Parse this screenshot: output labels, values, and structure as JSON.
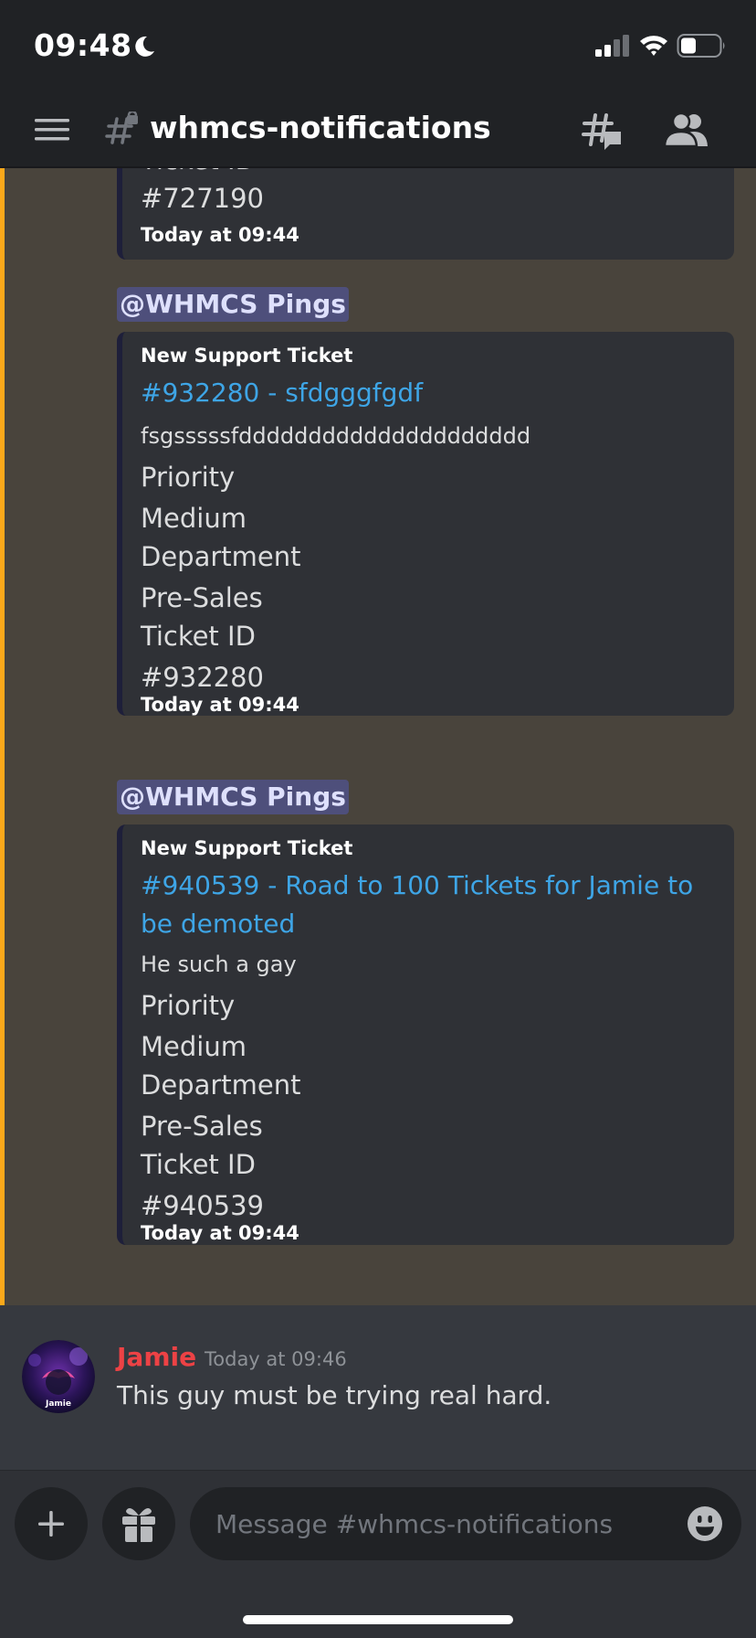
{
  "status_bar": {
    "time": "09:48"
  },
  "header": {
    "channel_name": "whmcs-notifications"
  },
  "messages": {
    "embed_top": {
      "field_name": "Ticket ID",
      "field_value": "#727190",
      "footer": "Today at 09:44"
    },
    "mention_1": "@WHMCS Pings",
    "embed_1": {
      "author": "New Support Ticket",
      "title": "#932280 - sfdgggfgdf",
      "description": "fsgsssssfddddddddddddddddddddd",
      "fields": [
        {
          "name": "Priority",
          "value": "Medium"
        },
        {
          "name": "Department",
          "value": "Pre-Sales"
        },
        {
          "name": "Ticket ID",
          "value": "#932280"
        }
      ],
      "footer": "Today at 09:44"
    },
    "mention_2": "@WHMCS Pings",
    "embed_2": {
      "author": "New Support Ticket",
      "title": "#940539 - Road to 100 Tickets for Jamie to be demoted",
      "description": "He such a gay",
      "fields": [
        {
          "name": "Priority",
          "value": "Medium"
        },
        {
          "name": "Department",
          "value": "Pre-Sales"
        },
        {
          "name": "Ticket ID",
          "value": "#940539"
        }
      ],
      "footer": "Today at 09:44"
    },
    "chat": {
      "author": "Jamie",
      "timestamp": "Today at 09:46",
      "text": "This guy must be trying real hard.",
      "avatar_text": "Jamie"
    }
  },
  "composer": {
    "placeholder": "Message #whmcs-notifications"
  },
  "icons": {
    "moon": "moon-icon",
    "signal": "cellular-signal-icon",
    "wifi": "wifi-icon",
    "battery": "battery-icon",
    "menu": "hamburger-menu-icon",
    "channel": "locked-hash-icon",
    "threads": "threads-icon",
    "members": "members-icon",
    "plus": "plus-icon",
    "gift": "gift-icon",
    "emoji": "emoji-icon"
  },
  "colors": {
    "background": "#36393f",
    "header": "#202225",
    "highlight": "#49443c",
    "highlight_bar": "#faa81a",
    "embed_bg": "#2f3136",
    "link": "#3ea5e6",
    "mention_text": "#dee0fc",
    "author_red": "#ed4245"
  }
}
